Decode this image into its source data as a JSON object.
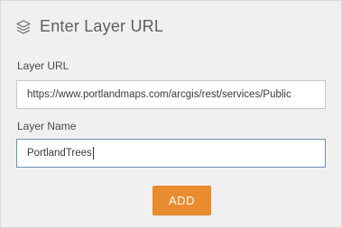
{
  "header": {
    "icon": "layers-icon",
    "title": "Enter Layer URL"
  },
  "form": {
    "layer_url": {
      "label": "Layer URL",
      "value": "https://www.portlandmaps.com/arcgis/rest/services/Public"
    },
    "layer_name": {
      "label": "Layer Name",
      "value": "PortlandTrees"
    },
    "add_button_label": "ADD"
  },
  "colors": {
    "panel_bg": "#f0f0f0",
    "button_bg": "#e98b2f",
    "focus_border": "#6b8fb5"
  }
}
